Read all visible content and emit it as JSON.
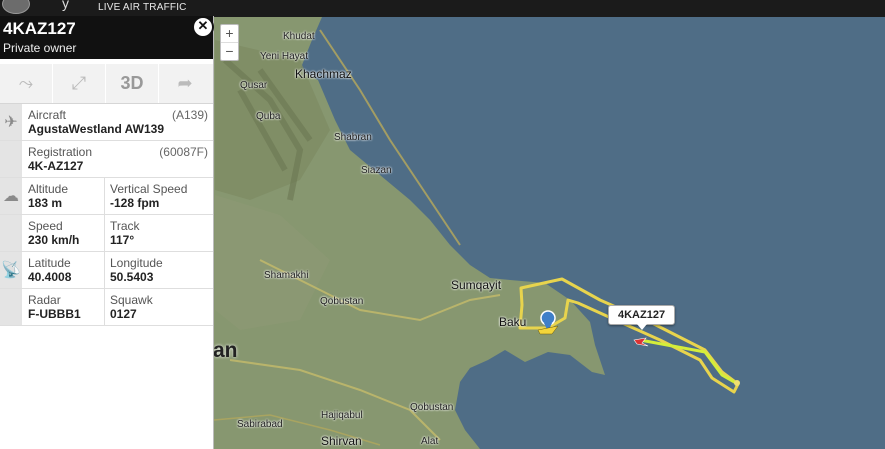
{
  "header": {
    "tagline": "LIVE AIR TRAFFIC"
  },
  "zoom": {
    "in_label": "+",
    "out_label": "−"
  },
  "panel": {
    "callsign": "4KAZ127",
    "owner": "Private owner",
    "close_label": "✕",
    "tools": {
      "route_icon": "⤳",
      "fit_icon": "⤢",
      "label_3d": "3D",
      "share_icon": "➦"
    },
    "aircraft": {
      "label": "Aircraft",
      "code": "(A139)",
      "value": "AgustaWestland AW139"
    },
    "registration": {
      "label": "Registration",
      "code": "(60087F)",
      "value": "4K-AZ127"
    },
    "altitude": {
      "label": "Altitude",
      "value": "183 m"
    },
    "vertical_speed": {
      "label": "Vertical Speed",
      "value": "-128 fpm"
    },
    "speed": {
      "label": "Speed",
      "value": "230 km/h"
    },
    "track": {
      "label": "Track",
      "value": "117°"
    },
    "latitude": {
      "label": "Latitude",
      "value": "40.4008"
    },
    "longitude": {
      "label": "Longitude",
      "value": "50.5403"
    },
    "radar": {
      "label": "Radar",
      "value": "F-UBBB1"
    },
    "squawk": {
      "label": "Squawk",
      "value": "0127"
    }
  },
  "map": {
    "places": {
      "khudat": "Khudat",
      "yeni_hayat": "Yeni Hayat",
      "khachmaz": "Khachmaz",
      "qusar": "Qusar",
      "quba": "Quba",
      "shabran": "Shabran",
      "siazan": "Siazan",
      "shamakhi": "Shamakhi",
      "qobustan1": "Qobustan",
      "sumqayit": "Sumqayit",
      "baku": "Baku",
      "sabirabad": "Sabirabad",
      "hajiqabul": "Hajiqabul",
      "qobustan2": "Qobustan",
      "shirvan": "Shirvan",
      "alat": "Alat",
      "country_fragment": "an"
    },
    "flight_label": "4KAZ127",
    "colors": {
      "sea": "#4c6a82",
      "track": "#e8d44d",
      "track_recent": "#d4ee3a",
      "land": "#8b9a6e"
    }
  }
}
